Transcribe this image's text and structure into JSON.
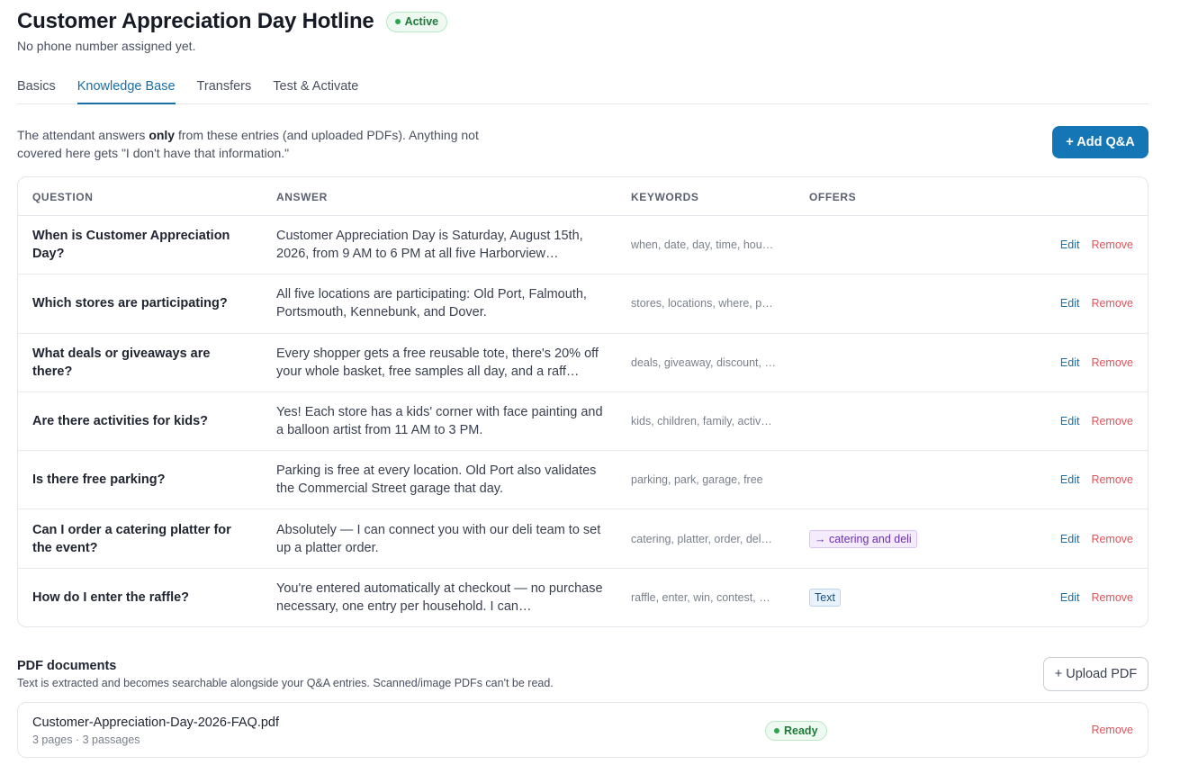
{
  "header": {
    "title": "Customer Appreciation Day Hotline",
    "status": "Active",
    "subtitle": "No phone number assigned yet."
  },
  "tabs": [
    {
      "label": "Basics",
      "active": false
    },
    {
      "label": "Knowledge Base",
      "active": true
    },
    {
      "label": "Transfers",
      "active": false
    },
    {
      "label": "Test & Activate",
      "active": false
    }
  ],
  "intro": {
    "before": "The attendant answers ",
    "emphasis": "only",
    "after": " from these entries (and uploaded PDFs). Anything not covered here gets \"I don't have that information.\""
  },
  "add_button": "+ Add Q&A",
  "table": {
    "headers": {
      "question": "QUESTION",
      "answer": "ANSWER",
      "keywords": "KEYWORDS",
      "offers": "OFFERS"
    },
    "edit_label": "Edit",
    "remove_label": "Remove",
    "rows": [
      {
        "question": "When is Customer Appreciation Day?",
        "answer": "Customer Appreciation Day is Saturday, August 15th, 2026, from 9 AM to 6 PM at all five Harborview…",
        "keywords": "when, date, day, time, hou…",
        "offer": "",
        "offer_style": ""
      },
      {
        "question": "Which stores are participating?",
        "answer": "All five locations are participating: Old Port, Falmouth, Portsmouth, Kennebunk, and Dover.",
        "keywords": "stores, locations, where, p…",
        "offer": "",
        "offer_style": ""
      },
      {
        "question": "What deals or giveaways are there?",
        "answer": "Every shopper gets a free reusable tote, there's 20% off your whole basket, free samples all day, and a raff…",
        "keywords": "deals, giveaway, discount, …",
        "offer": "",
        "offer_style": ""
      },
      {
        "question": "Are there activities for kids?",
        "answer": "Yes! Each store has a kids' corner with face painting and a balloon artist from 11 AM to 3 PM.",
        "keywords": "kids, children, family, activ…",
        "offer": "",
        "offer_style": ""
      },
      {
        "question": "Is there free parking?",
        "answer": "Parking is free at every location. Old Port also validates the Commercial Street garage that day.",
        "keywords": "parking, park, garage, free",
        "offer": "",
        "offer_style": ""
      },
      {
        "question": "Can I order a catering platter for the event?",
        "answer": "Absolutely — I can connect you with our deli team to set up a platter order.",
        "keywords": "catering, platter, order, del…",
        "offer": "→ catering and deli",
        "offer_style": "purple"
      },
      {
        "question": "How do I enter the raffle?",
        "answer": "You're entered automatically at checkout — no purchase necessary, one entry per household. I can…",
        "keywords": "raffle, enter, win, contest, …",
        "offer": "Text",
        "offer_style": "blue"
      }
    ]
  },
  "pdf": {
    "title": "PDF documents",
    "description": "Text is extracted and becomes searchable alongside your Q&A entries. Scanned/image PDFs can't be read.",
    "upload_label": "+ Upload PDF",
    "file": {
      "name": "Customer-Appreciation-Day-2026-FAQ.pdf",
      "meta": "3 pages · 3 passages",
      "status": "Ready",
      "remove_label": "Remove"
    }
  },
  "colors": {
    "accent": "#1576b6",
    "active_tab": "#1a6ea8",
    "remove": "#e0525a",
    "success": "#1e7a3a"
  }
}
